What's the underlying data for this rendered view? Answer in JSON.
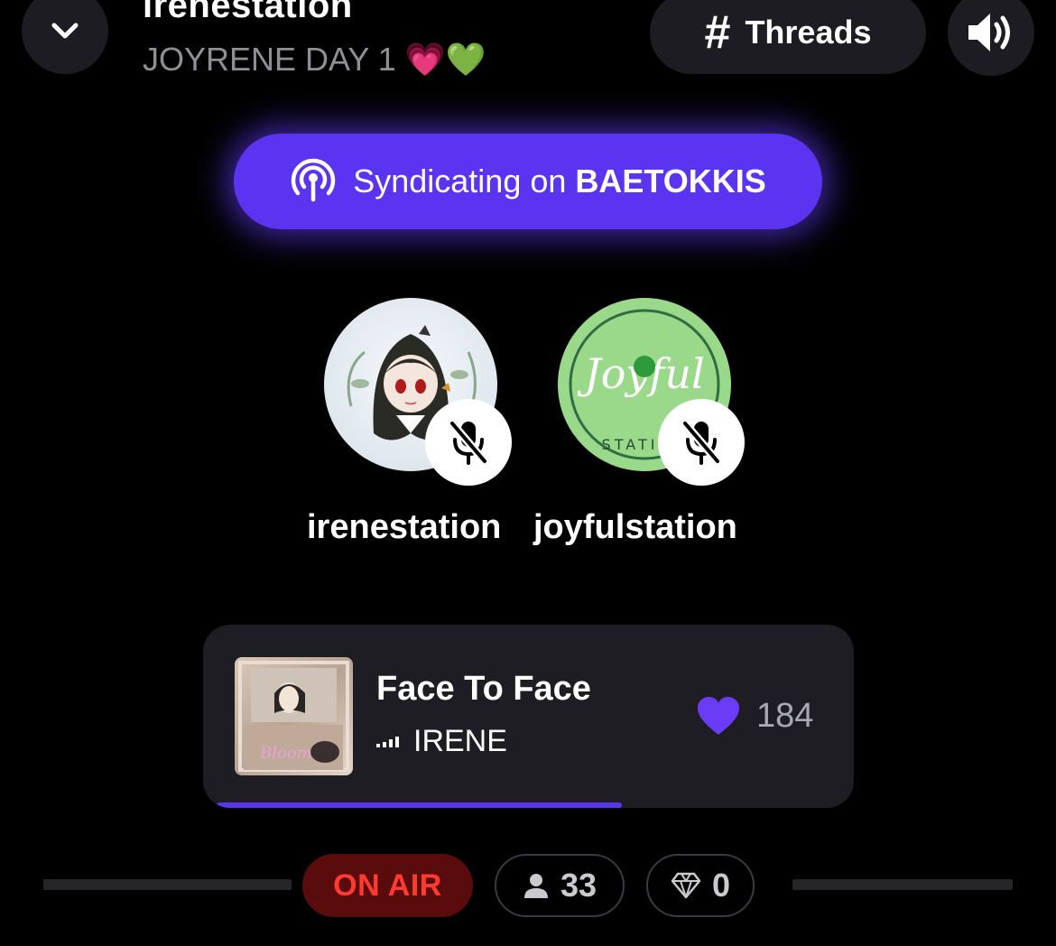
{
  "header": {
    "station_name": "irenestation",
    "subtitle": "JOYRENE DAY 1 💗💚",
    "threads_label": "Threads",
    "threads_icon": "hash-icon",
    "back_icon": "chevron-down-icon",
    "speaker_icon": "speaker-icon"
  },
  "syndicating": {
    "prefix": "Syndicating on",
    "channel": "BAETOKKIS",
    "icon": "broadcast-icon"
  },
  "hosts": [
    {
      "name": "irenestation",
      "muted": true,
      "icon": "mic-off-icon"
    },
    {
      "name": "joyfulstation",
      "muted": true,
      "icon": "mic-off-icon",
      "logo_text": "Joyful",
      "logo_sub": "STATI"
    }
  ],
  "now_playing": {
    "title": "Face To Face",
    "artist": "IRENE",
    "likes": "184",
    "like_icon": "heart-icon",
    "progress": 0.65
  },
  "status": {
    "on_air": "ON AIR",
    "listeners": "33",
    "listeners_icon": "person-icon",
    "gems": "0",
    "gems_icon": "diamond-icon"
  },
  "colors": {
    "accent": "#5b34f2",
    "on_air_bg": "#5a0c0c",
    "on_air_text": "#ff3b30",
    "card_bg": "#1d1d23"
  }
}
